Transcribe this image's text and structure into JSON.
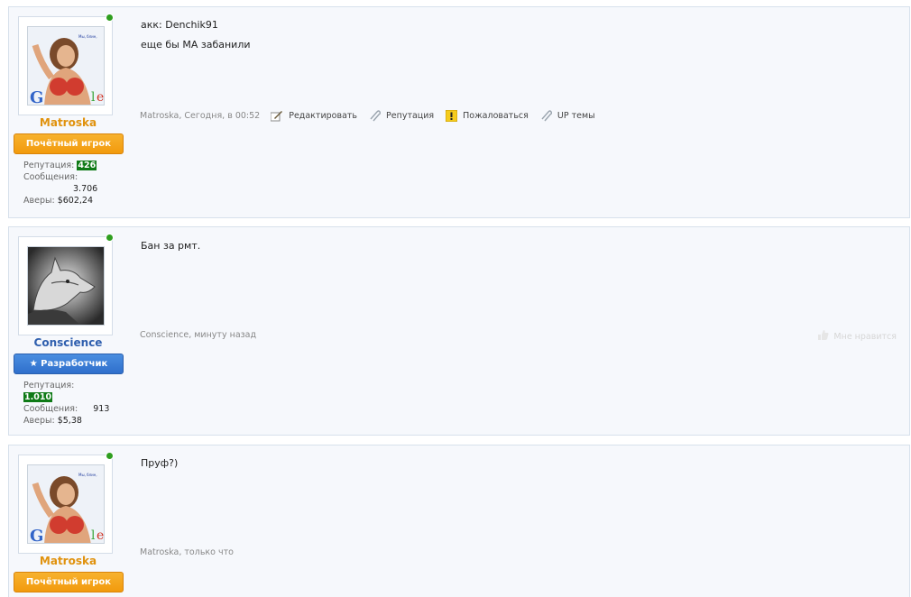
{
  "posts": [
    {
      "username": "Matroska",
      "rank": "Почётный игрок",
      "stats": {
        "rep_label": "Репутация:",
        "rep_value": "426",
        "msg_label": "Сообщения:",
        "msg_value": "3.706",
        "avers_label": "Аверы:",
        "avers_value": "$602,24"
      },
      "lines": [
        "акк: Denchik91",
        "еще бы МА забанили"
      ],
      "meta": "Matroska, Сегодня, в 00:52",
      "actions": [
        {
          "label": "Редактировать",
          "icon": "edit-icon"
        },
        {
          "label": "Репутация",
          "icon": "paperclip-icon"
        },
        {
          "label": "Пожаловаться",
          "icon": "warning-icon"
        },
        {
          "label": "UP темы",
          "icon": "paperclip-icon"
        }
      ]
    },
    {
      "username": "Conscience",
      "rank": "★ Разработчик",
      "stats": {
        "rep_label": "Репутация:",
        "rep_value": "1.010",
        "msg_label": "Сообщения:",
        "msg_value": "913",
        "avers_label": "Аверы:",
        "avers_value": "$5,38"
      },
      "lines": [
        "Бан за рмт."
      ],
      "meta": "Conscience, минуту назад",
      "like_label": "Мне нравится"
    },
    {
      "username": "Matroska",
      "rank": "Почётный игрок",
      "lines": [
        "Пруф?)"
      ],
      "meta": "Matroska, только что"
    }
  ],
  "colors": {
    "rank_honored": "#f29a0d",
    "rank_developer": "#2f6fcc",
    "reputation_positive": "#0f7a17",
    "username_orange": "#e0920e",
    "username_blue": "#2f5fae",
    "online": "#2f9e1f"
  }
}
